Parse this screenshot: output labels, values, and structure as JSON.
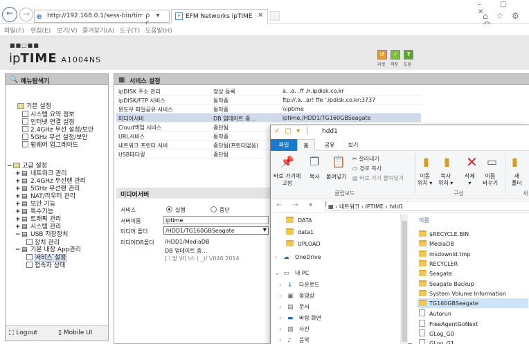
{
  "browser": {
    "url": "http://192.168.0.1/sess-bin/timepro.c",
    "address_icons": "ρ ▾ c",
    "tab_title": "EFM Networks ipTIME A10...",
    "tab_close": "✕",
    "window_controls": "– □ ✕",
    "toolbar_icons": "⌂ ☆ ⚙ ☺",
    "menu": [
      "파일(F)",
      "편집(E)",
      "보기(V)",
      "즐겨찾기(A)",
      "도구(T)",
      "도움말(H)"
    ]
  },
  "header": {
    "logo_dots": "■■□■■",
    "logo_text_ip": "ip",
    "logo_text_time": "TIME",
    "model": "A1004NS",
    "buttons": [
      {
        "label": "리셋",
        "glyph": "↺",
        "color": "#e89a2a"
      },
      {
        "label": "저장",
        "glyph": "✓",
        "color": "#7bbf3a"
      },
      {
        "label": "도움",
        "glyph": "?",
        "color": "#5aa832"
      }
    ]
  },
  "left_panel": {
    "title": "메뉴탐색기",
    "tree": [
      {
        "text": "기본 설정",
        "type": "group"
      },
      {
        "text": "시스템 요약 정보",
        "type": "item"
      },
      {
        "text": "인터넷 연결 설정",
        "type": "item"
      },
      {
        "text": "2.4GHz 무선 설정/보안",
        "type": "item"
      },
      {
        "text": "5GHz 무선 설정/보안",
        "type": "item"
      },
      {
        "text": "펌웨어 업그레이드",
        "type": "item"
      },
      {
        "text": "고급 설정",
        "type": "group"
      },
      {
        "text": "네트워크 관리",
        "type": "sub"
      },
      {
        "text": "2.4GHz 무선랜 관리",
        "type": "sub"
      },
      {
        "text": "5GHz 무선랜 관리",
        "type": "sub"
      },
      {
        "text": "NAT/라우터 관리",
        "type": "sub"
      },
      {
        "text": "보안 기능",
        "type": "sub"
      },
      {
        "text": "특수기능",
        "type": "sub"
      },
      {
        "text": "트래픽 관리",
        "type": "sub"
      },
      {
        "text": "시스템 관리",
        "type": "sub"
      },
      {
        "text": "USB 저장장치",
        "type": "sub"
      },
      {
        "text": "장치 관리",
        "type": "leaf"
      },
      {
        "text": "기본 내장 App관리",
        "type": "sub"
      },
      {
        "text": "서비스 설정",
        "type": "leaf"
      },
      {
        "text": "접속자 상태",
        "type": "leaf"
      }
    ],
    "footer_logout": "Logout",
    "footer_mobile": "Mobile UI"
  },
  "main_panel": {
    "title": "서비스 설정",
    "services": [
      {
        "name": "ipDISK 주소 관리",
        "status": "정상 등록",
        "detail": "a.  .a.    .ff    .h.ipdisk.co.kr"
      },
      {
        "name": "ipDISK/FTP 서비스",
        "status": "동작중",
        "detail": "ftp://.a.   .ar!    ffe   '.ipdisk.co.kr:3737"
      },
      {
        "name": "윈도우 파일공유 서비스",
        "status": "동작중",
        "detail": "\\\\iptime"
      },
      {
        "name": "미디어서버",
        "status": "DB 업데이트 중...",
        "detail": "iptime,/HDD1/TG160GBSeagate"
      },
      {
        "name": "Cloud백업 서비스",
        "status": "중단됨",
        "detail": ""
      },
      {
        "name": "URL서비스",
        "status": "동작중",
        "detail": ""
      },
      {
        "name": "네트워크 프린터 서버",
        "status": "중단됨(프린터없음)",
        "detail": ""
      },
      {
        "name": "USB테더링",
        "status": "중단됨",
        "detail": ""
      }
    ],
    "media": {
      "title": "미디어서버",
      "service_label": "서비스",
      "option_run": "실행",
      "option_stop": "중단",
      "name_label": "서버이름",
      "name_value": "iptime",
      "folder_label": "미디어 폴더",
      "folder_value": "/HDD1/TG160GBSeagate",
      "db_label": "미디어DB폴더",
      "db_path": "/HDD1/MediaDB",
      "db_status": "DB 업데이트 중...",
      "db_progress": "[     \\  방  \\비   \\스 ( _)/   \\/046 2014"
    }
  },
  "explorer": {
    "title": "hdd1",
    "quick_access": "✓ ▢ ▾ │",
    "tabs": [
      "파일",
      "홈",
      "공유",
      "보기"
    ],
    "ribbon": {
      "pin": "바로 가기에\n고정",
      "copy": "복사",
      "paste": "붙여넣기",
      "cut": "잘라내기",
      "copy_path": "경로 복사",
      "paste_shortcut": "바로 가기 붙여넣기",
      "clipboard_group": "클립보드",
      "move": "이동\n위치 ▾",
      "copy_to": "복사\n위치 ▾",
      "delete": "삭제\n▾",
      "rename": "이름\n바꾸기",
      "organize_group": "구성",
      "new_folder": "새\n폴더",
      "new_group": "새"
    },
    "nav_arrows": "← → ▾ ↑",
    "path": "›   네트워크  ›  IPTIME  ›  hdd1",
    "left_items": [
      {
        "text": "DATA",
        "kind": "folder"
      },
      {
        "text": "data1",
        "kind": "folder"
      },
      {
        "text": "UPLOAD",
        "kind": "folder"
      },
      {
        "text": "OneDrive",
        "kind": "cloud"
      },
      {
        "text": "내 PC",
        "kind": "pc"
      },
      {
        "text": "다운로드",
        "kind": "down"
      },
      {
        "text": "동영상",
        "kind": "video"
      },
      {
        "text": "문서",
        "kind": "doc"
      },
      {
        "text": "바탕 화면",
        "kind": "desktop"
      },
      {
        "text": "사진",
        "kind": "pic"
      },
      {
        "text": "음악",
        "kind": "music"
      }
    ],
    "column_name": "이름",
    "files": [
      {
        "name": "$RECYCLE.BIN",
        "kind": "folder"
      },
      {
        "name": "MediaDB",
        "kind": "folder"
      },
      {
        "name": "msdownld.tmp",
        "kind": "folder"
      },
      {
        "name": "RECYCLER",
        "kind": "folder"
      },
      {
        "name": "Seagate",
        "kind": "folder"
      },
      {
        "name": "Seagate Backup",
        "kind": "folder"
      },
      {
        "name": "System Volume Information",
        "kind": "folder"
      },
      {
        "name": "TG160GBSeagate",
        "kind": "folder",
        "selected": true
      },
      {
        "name": "Autorun",
        "kind": "file"
      },
      {
        "name": "FreeAgentGoNext",
        "kind": "file"
      },
      {
        "name": "GLog_G0",
        "kind": "file"
      },
      {
        "name": "GLog_G1",
        "kind": "file"
      }
    ]
  }
}
